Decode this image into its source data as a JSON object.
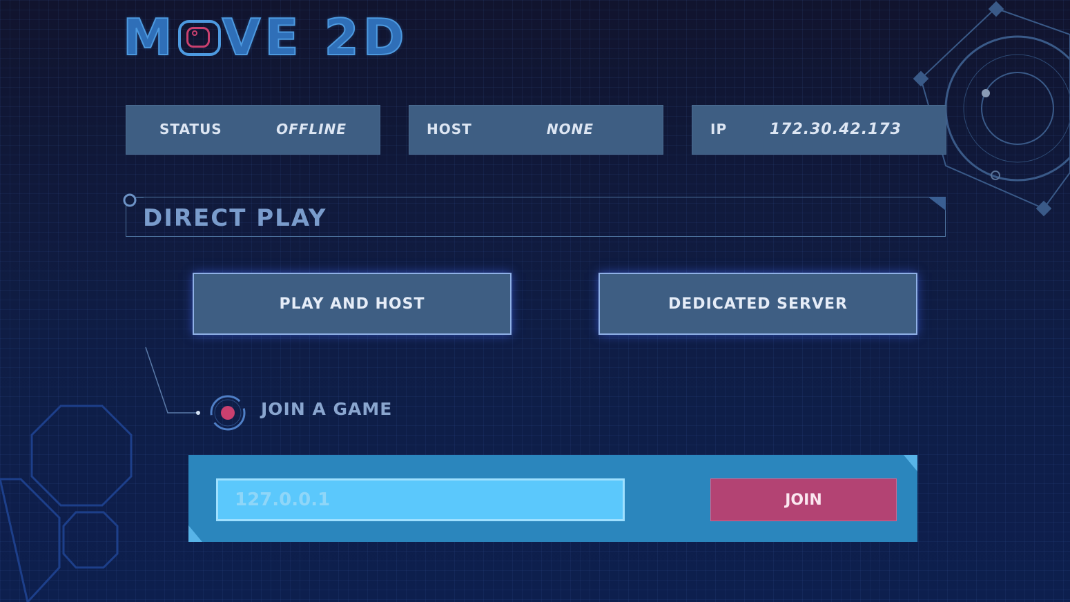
{
  "logo": {
    "text_before": "M",
    "text_after": "VE 2D"
  },
  "status_bar": {
    "status": {
      "label": "STATUS",
      "value": "OFFLINE"
    },
    "host": {
      "label": "HOST",
      "value": "NONE"
    },
    "ip": {
      "label": "IP",
      "value": "172.30.42.173"
    }
  },
  "direct_play": {
    "title": "DIRECT PLAY",
    "play_and_host_label": "PLAY AND HOST",
    "dedicated_server_label": "DEDICATED SERVER"
  },
  "join": {
    "title": "JOIN A GAME",
    "address_value": "",
    "address_placeholder": "127.0.0.1",
    "join_label": "JOIN"
  },
  "colors": {
    "background": "#101c3e",
    "tile": "#3e5e83",
    "panel": "#2b86bd",
    "input": "#5bc8fc",
    "join_button": "#b34373",
    "accent_pink": "#c9406f"
  }
}
